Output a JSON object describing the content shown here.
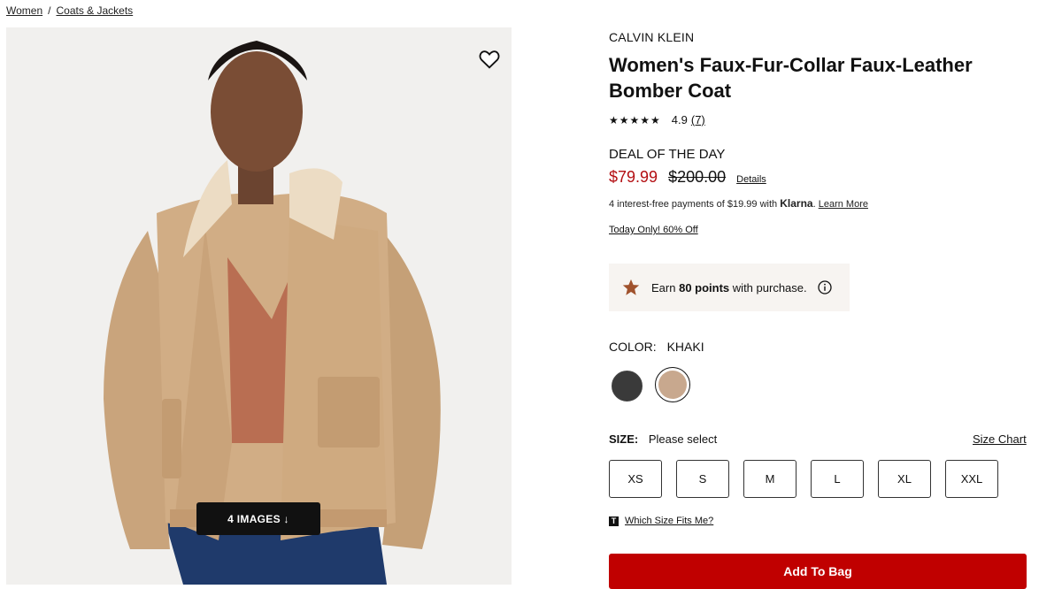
{
  "breadcrumb": {
    "items": [
      "Women",
      "Coats & Jackets"
    ],
    "separator": "/"
  },
  "gallery": {
    "images_button": "4 IMAGES ↓",
    "favorite_icon": "heart-icon"
  },
  "product": {
    "brand": "CALVIN KLEIN",
    "title": "Women's Faux-Fur-Collar Faux-Leather Bomber Coat",
    "rating": {
      "stars": "★★★★★",
      "value": "4.9",
      "count": "(7)"
    },
    "deal_label": "DEAL OF THE DAY",
    "price_sale": "$79.99",
    "price_original": "$200.00",
    "details_link": "Details",
    "klarna": {
      "prefix": "4 interest-free payments of $19.99 with",
      "brand": "Klarna",
      "learn_more": "Learn More"
    },
    "promo": "Today Only! 60% Off",
    "points": {
      "prefix": "Earn",
      "bold": "80 points",
      "suffix": "with purchase."
    },
    "color": {
      "label": "COLOR:",
      "value": "KHAKI",
      "swatches": [
        "#3a3a3a",
        "#c8a88e"
      ]
    },
    "size": {
      "label": "SIZE:",
      "value": "Please select",
      "chart_link": "Size Chart",
      "options": [
        "XS",
        "S",
        "M",
        "L",
        "XL",
        "XXL"
      ],
      "fit_link": "Which Size Fits Me?"
    },
    "add_to_bag": "Add To Bag"
  },
  "colors": {
    "sale": "#b30e12",
    "cta": "#c00000"
  }
}
